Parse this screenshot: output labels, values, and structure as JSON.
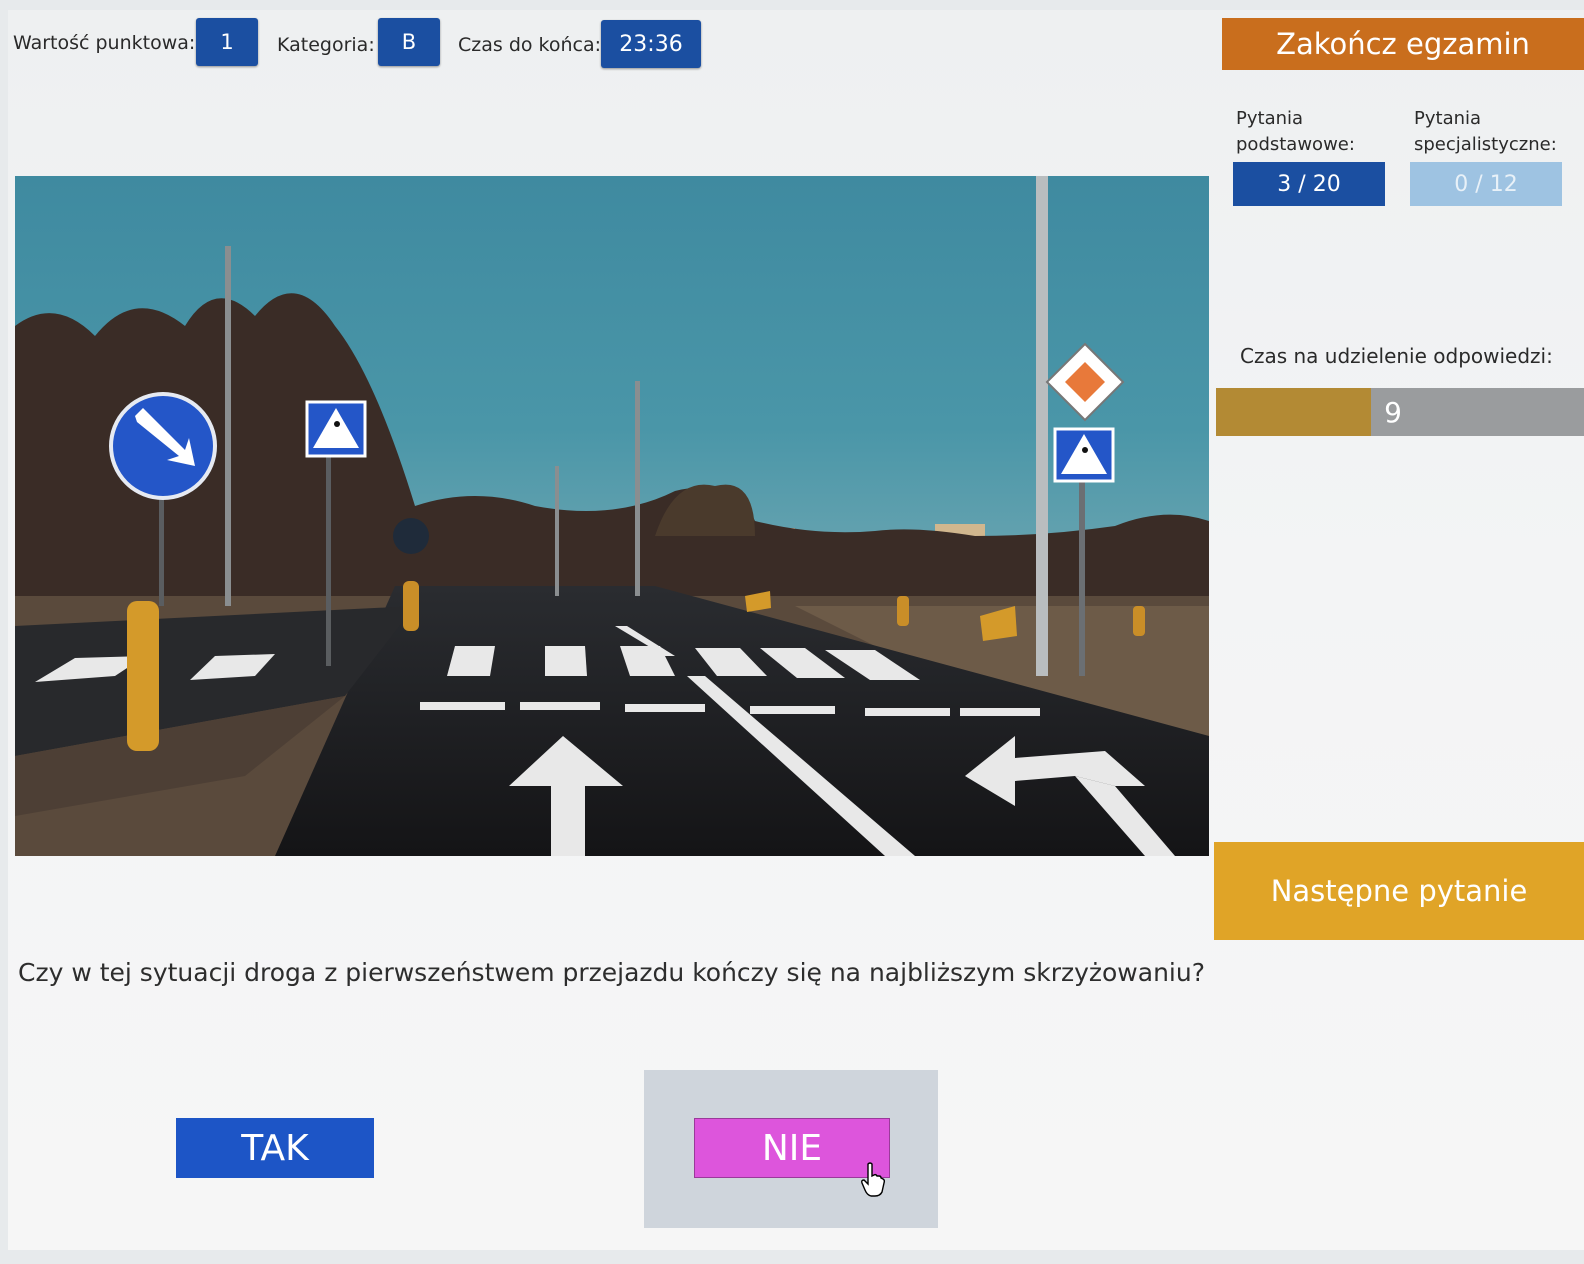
{
  "header": {
    "points_label": "Wartość punktowa:",
    "points_value": "1",
    "category_label": "Kategoria:",
    "category_value": "B",
    "time_left_label": "Czas do końca:",
    "time_left_value": "23:36",
    "end_exam_label": "Zakończ egzamin"
  },
  "sidebar": {
    "basic_label_1": "Pytania",
    "basic_label_2": "podstawowe:",
    "basic_count": "3 / 20",
    "special_label_1": "Pytania",
    "special_label_2": "specjalistyczne:",
    "special_count": "0 / 12",
    "answer_time_label": "Czas na udzielenie odpowiedzi:",
    "answer_time_value": "9",
    "answer_time_fraction": 0.42,
    "next_question_label": "Następne pytanie"
  },
  "question": {
    "text": "Czy w tej sytuacji droga z pierwszeństwem przejazdu kończy się na najbliższym skrzyżowaniu?"
  },
  "answers": {
    "yes_label": "TAK",
    "no_label": "NIE"
  },
  "colors": {
    "accent_blue": "#1b4fa1",
    "end_orange": "#c96e1d",
    "next_yellow": "#e0a427",
    "selected_magenta": "#dd55dc"
  }
}
